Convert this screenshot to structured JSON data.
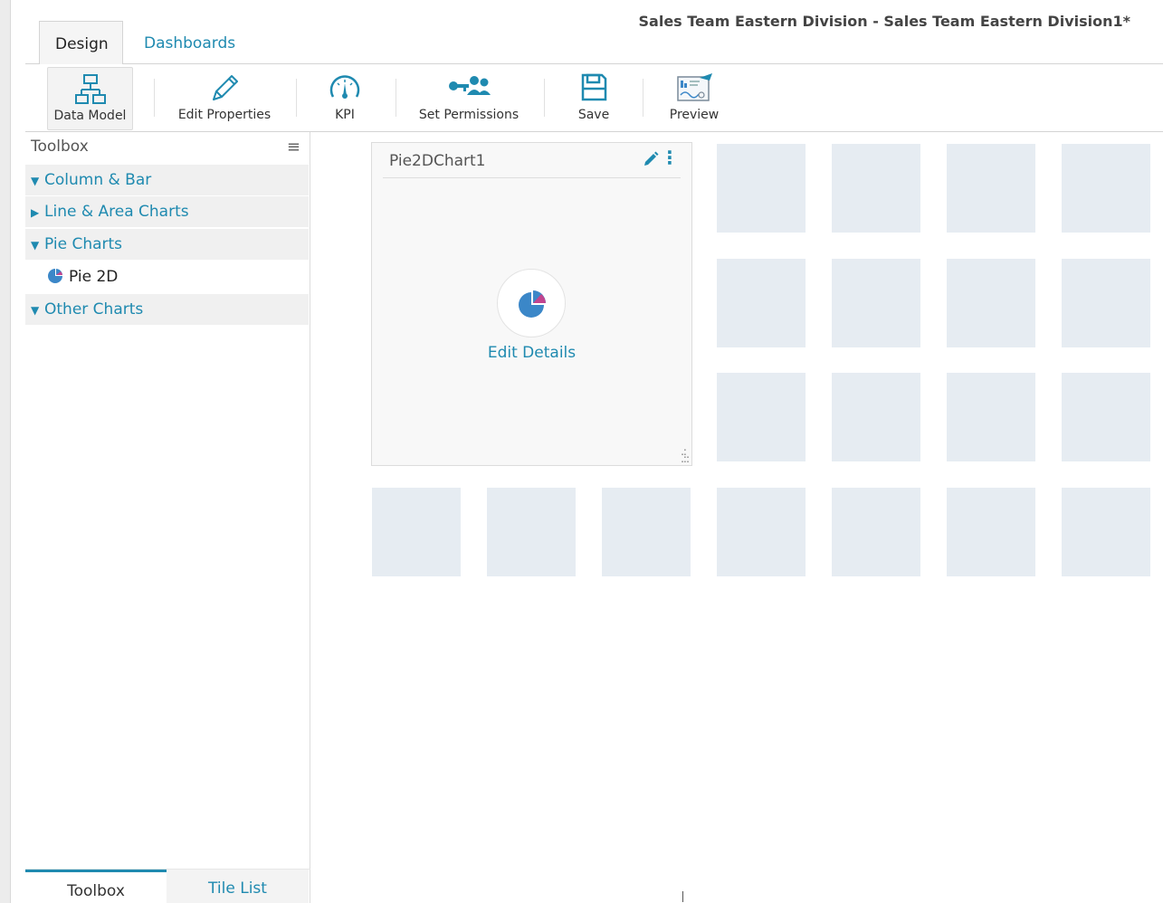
{
  "document_title": "Sales Team Eastern Division - Sales Team Eastern Division1*",
  "tabs": [
    {
      "label": "Design",
      "active": true
    },
    {
      "label": "Dashboards",
      "active": false
    }
  ],
  "toolbar": {
    "data_model": "Data Model",
    "edit_properties": "Edit Properties",
    "kpi": "KPI",
    "set_permissions": "Set Permissions",
    "save": "Save",
    "preview": "Preview"
  },
  "sidebar": {
    "title": "Toolbox",
    "groups": [
      {
        "label": "Column & Bar",
        "expanded": true
      },
      {
        "label": "Line & Area Charts",
        "expanded": false
      },
      {
        "label": "Pie Charts",
        "expanded": true
      },
      {
        "label": "Other Charts",
        "expanded": true
      }
    ],
    "items": [
      {
        "label": "Pie 2D",
        "icon": "pie-chart-icon"
      }
    ],
    "bottom_tabs": [
      {
        "label": "Toolbox",
        "active": true
      },
      {
        "label": "Tile List",
        "active": false
      }
    ]
  },
  "chart_tile": {
    "title": "Pie2DChart1",
    "action_label": "Edit Details"
  },
  "colors": {
    "accent": "#1f8ab0",
    "tile_placeholder": "#e6ecf2",
    "pie_blue": "#3b87c8",
    "pie_pink": "#c2458f"
  }
}
